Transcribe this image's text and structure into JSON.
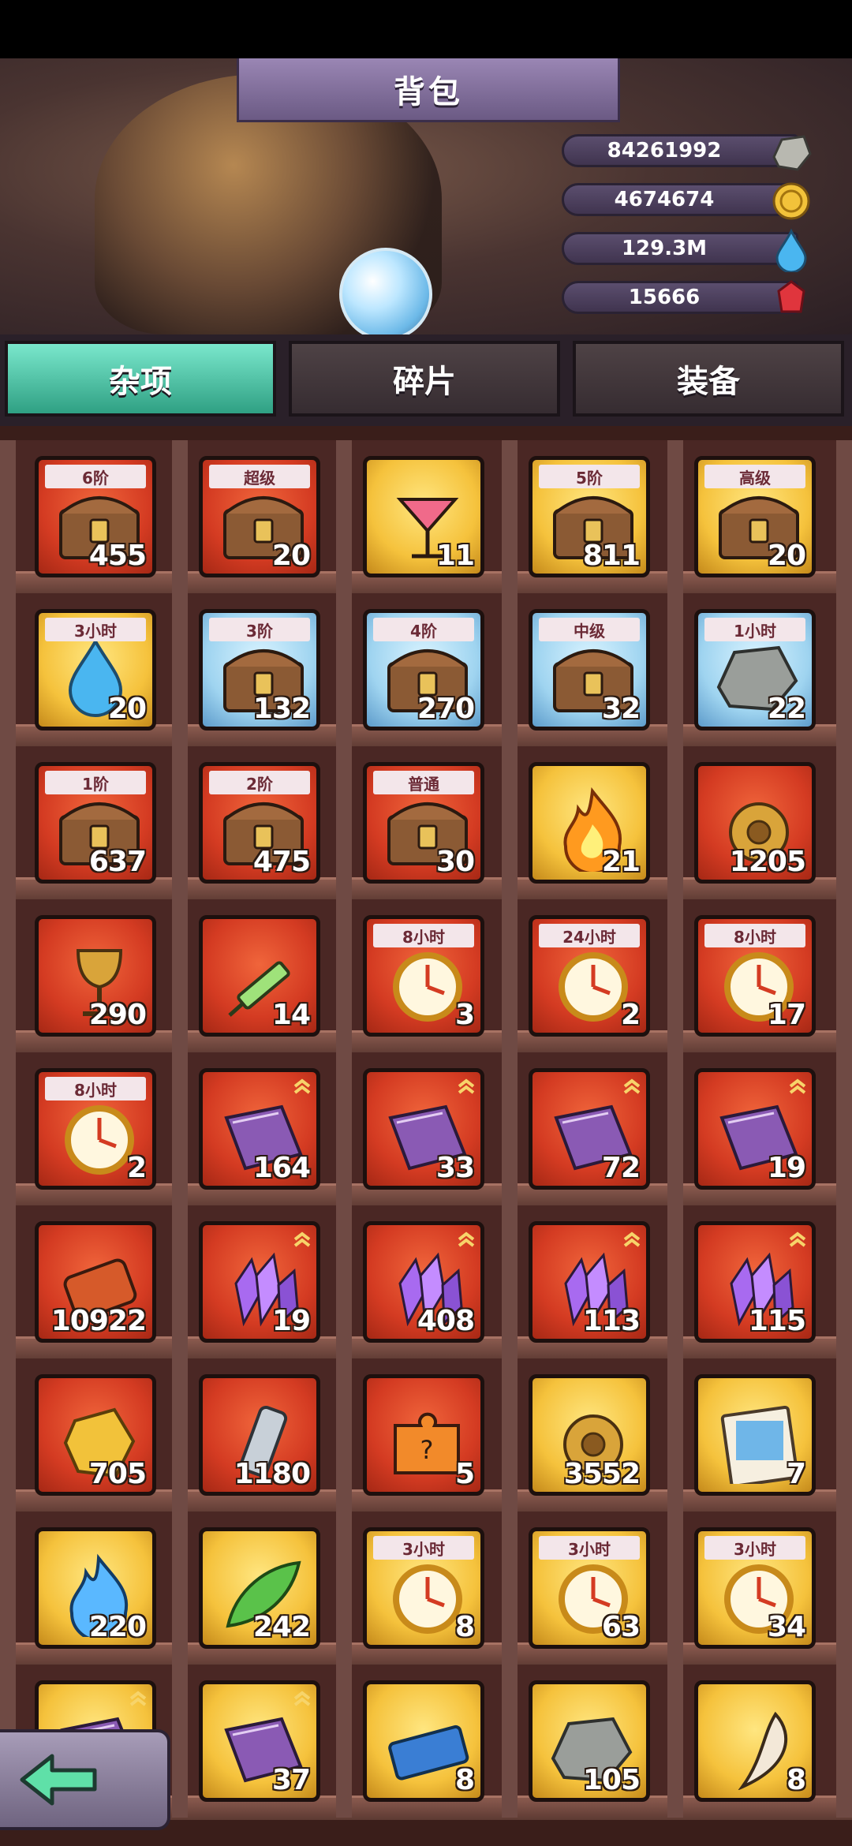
{
  "header": {
    "title": "背包"
  },
  "currencies": [
    {
      "value": "84261992",
      "icon": "stone-icon",
      "color": "#b8b8b0"
    },
    {
      "value": "4674674",
      "icon": "gold-coin-icon",
      "color": "#f2c23a"
    },
    {
      "value": "129.3M",
      "icon": "water-drop-icon",
      "color": "#4ab6f0"
    },
    {
      "value": "15666",
      "icon": "red-gem-icon",
      "color": "#e0353d"
    }
  ],
  "tabs": [
    {
      "label": "杂项",
      "active": true
    },
    {
      "label": "碎片",
      "active": false
    },
    {
      "label": "装备",
      "active": false
    }
  ],
  "items": [
    {
      "tag": "6阶",
      "count": "455",
      "bg": "red",
      "icon": "treasure-chest-icon"
    },
    {
      "tag": "超级",
      "count": "20",
      "bg": "red",
      "icon": "treasure-chest-icon"
    },
    {
      "tag": "",
      "count": "11",
      "bg": "gold",
      "icon": "cocktail-icon"
    },
    {
      "tag": "5阶",
      "count": "811",
      "bg": "gold",
      "icon": "treasure-chest-icon"
    },
    {
      "tag": "高级",
      "count": "20",
      "bg": "gold",
      "icon": "treasure-chest-icon"
    },
    {
      "tag": "3小时",
      "count": "20",
      "bg": "gold",
      "icon": "water-drop-icon"
    },
    {
      "tag": "3阶",
      "count": "132",
      "bg": "blue",
      "icon": "treasure-chest-icon"
    },
    {
      "tag": "4阶",
      "count": "270",
      "bg": "blue",
      "icon": "treasure-chest-icon"
    },
    {
      "tag": "中级",
      "count": "32",
      "bg": "blue",
      "icon": "treasure-chest-icon"
    },
    {
      "tag": "1小时",
      "count": "22",
      "bg": "blue",
      "icon": "stone-icon"
    },
    {
      "tag": "1阶",
      "count": "637",
      "bg": "red",
      "icon": "treasure-chest-icon"
    },
    {
      "tag": "2阶",
      "count": "475",
      "bg": "red",
      "icon": "treasure-chest-icon"
    },
    {
      "tag": "普通",
      "count": "30",
      "bg": "red",
      "icon": "treasure-chest-icon"
    },
    {
      "tag": "",
      "count": "21",
      "bg": "gold",
      "icon": "fire-icon"
    },
    {
      "tag": "",
      "count": "1205",
      "bg": "red",
      "icon": "gear-icon"
    },
    {
      "tag": "",
      "count": "290",
      "bg": "red",
      "icon": "goblet-icon"
    },
    {
      "tag": "",
      "count": "14",
      "bg": "red",
      "icon": "syringe-icon"
    },
    {
      "tag": "8小时",
      "count": "3",
      "bg": "red",
      "icon": "clock-icon"
    },
    {
      "tag": "24小时",
      "count": "2",
      "bg": "red",
      "icon": "clock-icon"
    },
    {
      "tag": "8小时",
      "count": "17",
      "bg": "red",
      "icon": "clock-icon"
    },
    {
      "tag": "8小时",
      "count": "2",
      "bg": "red",
      "icon": "clock-icon"
    },
    {
      "tag": "",
      "count": "164",
      "bg": "red",
      "icon": "book-icon",
      "chevron": true
    },
    {
      "tag": "",
      "count": "33",
      "bg": "red",
      "icon": "book-icon",
      "chevron": true
    },
    {
      "tag": "",
      "count": "72",
      "bg": "red",
      "icon": "book-icon",
      "chevron": true
    },
    {
      "tag": "",
      "count": "19",
      "bg": "red",
      "icon": "book-icon",
      "chevron": true
    },
    {
      "tag": "",
      "count": "10922",
      "bg": "red",
      "icon": "scroll-icon"
    },
    {
      "tag": "",
      "count": "19",
      "bg": "red",
      "icon": "crystal-icon",
      "chevron": true
    },
    {
      "tag": "",
      "count": "408",
      "bg": "red",
      "icon": "crystal-icon",
      "chevron": true
    },
    {
      "tag": "",
      "count": "113",
      "bg": "red",
      "icon": "crystal-icon",
      "chevron": true
    },
    {
      "tag": "",
      "count": "115",
      "bg": "red",
      "icon": "crystal-icon",
      "chevron": true
    },
    {
      "tag": "",
      "count": "705",
      "bg": "red",
      "icon": "gold-nugget-icon"
    },
    {
      "tag": "",
      "count": "1180",
      "bg": "red",
      "icon": "tube-icon"
    },
    {
      "tag": "",
      "count": "5",
      "bg": "red",
      "icon": "puzzle-icon"
    },
    {
      "tag": "",
      "count": "3552",
      "bg": "gold",
      "icon": "gear-icon"
    },
    {
      "tag": "",
      "count": "7",
      "bg": "gold",
      "icon": "photo-card-icon"
    },
    {
      "tag": "",
      "count": "220",
      "bg": "gold",
      "icon": "blue-flame-icon"
    },
    {
      "tag": "",
      "count": "242",
      "bg": "gold",
      "icon": "leaf-icon"
    },
    {
      "tag": "3小时",
      "count": "8",
      "bg": "gold",
      "icon": "clock-icon"
    },
    {
      "tag": "3小时",
      "count": "63",
      "bg": "gold",
      "icon": "clock-icon"
    },
    {
      "tag": "3小时",
      "count": "34",
      "bg": "gold",
      "icon": "clock-icon"
    },
    {
      "tag": "",
      "count": "",
      "bg": "gold",
      "icon": "book-icon",
      "chevron": true
    },
    {
      "tag": "",
      "count": "37",
      "bg": "gold",
      "icon": "book-icon",
      "chevron": true
    },
    {
      "tag": "",
      "count": "8",
      "bg": "gold",
      "icon": "ticket-icon"
    },
    {
      "tag": "",
      "count": "105",
      "bg": "gold",
      "icon": "stone-icon"
    },
    {
      "tag": "",
      "count": "8",
      "bg": "gold",
      "icon": "fang-icon"
    }
  ]
}
